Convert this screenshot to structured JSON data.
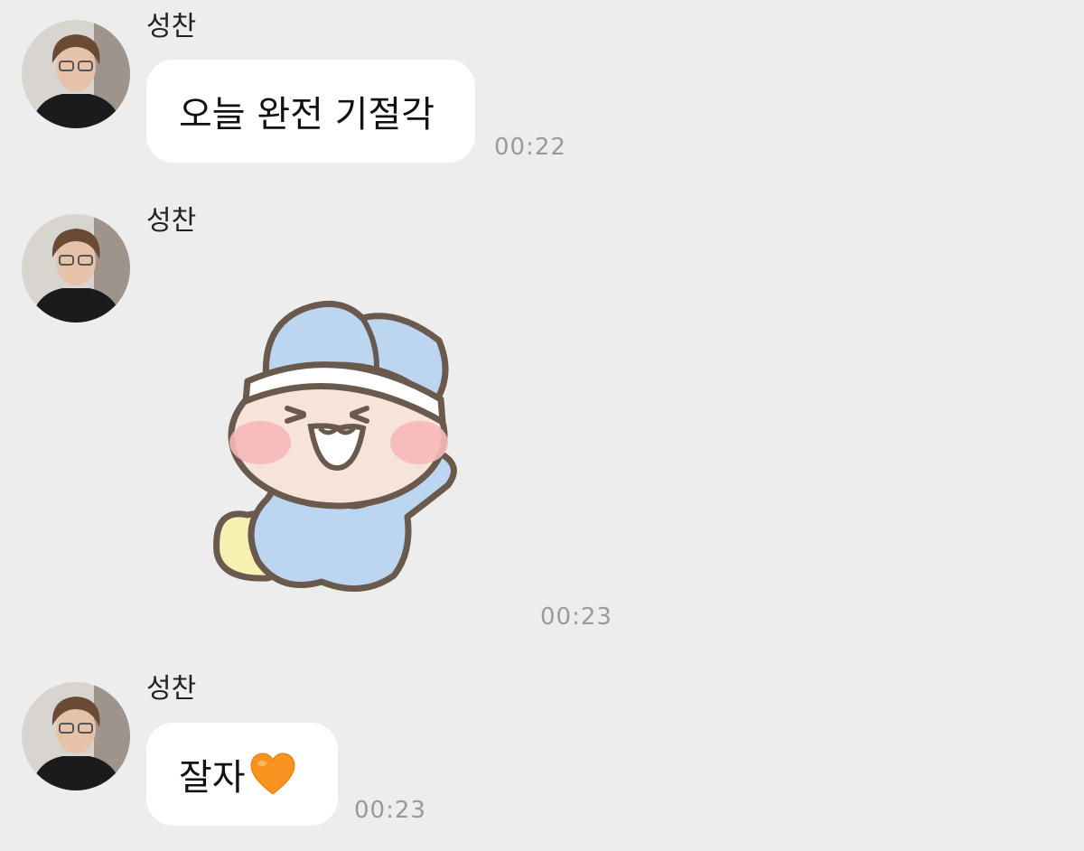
{
  "messages": [
    {
      "sender": "성찬",
      "text": "오늘 완전 기절각",
      "time": "00:22",
      "avatar_icon": "profile-photo"
    },
    {
      "sender": "성찬",
      "sticker_icon": "baby-bunny-sticker",
      "time": "00:23",
      "avatar_icon": "profile-photo"
    },
    {
      "sender": "성찬",
      "text": "잘자",
      "emoji_icon": "orange-heart-icon",
      "time": "00:23",
      "avatar_icon": "profile-photo"
    }
  ],
  "colors": {
    "background": "#ededed",
    "bubble": "#ffffff",
    "timestamp": "#9a9a9a",
    "heart": "#f7931e"
  }
}
